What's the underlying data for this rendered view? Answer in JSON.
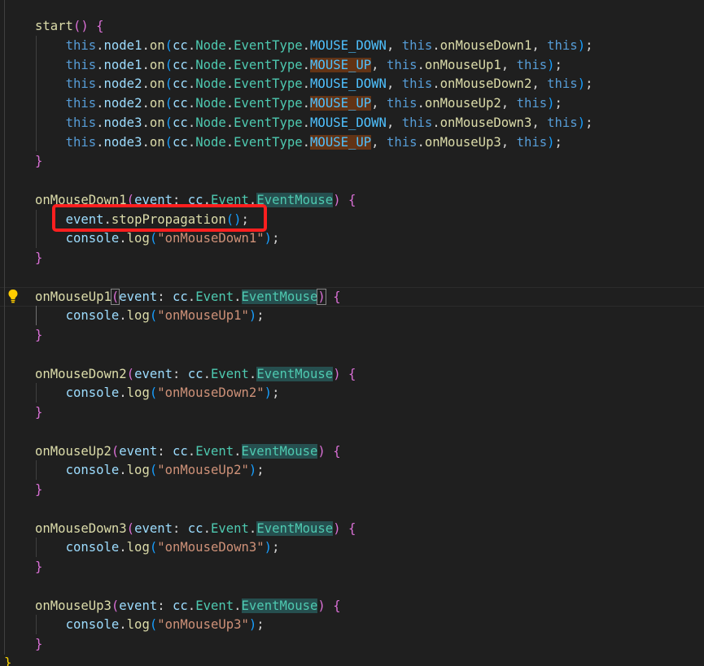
{
  "editor": {
    "lines": [
      [
        [
          "t-fn",
          "start"
        ],
        [
          "t-b2",
          "()"
        ],
        [
          "t-p",
          " "
        ],
        [
          "t-b2",
          "{"
        ]
      ],
      [
        [
          "t-p",
          "    "
        ],
        [
          "t-kw",
          "this"
        ],
        [
          "t-p",
          "."
        ],
        [
          "t-var",
          "node1"
        ],
        [
          "t-p",
          "."
        ],
        [
          "t-fn",
          "on"
        ],
        [
          "t-b3",
          "("
        ],
        [
          "t-var",
          "cc"
        ],
        [
          "t-p",
          "."
        ],
        [
          "t-type",
          "Node"
        ],
        [
          "t-p",
          "."
        ],
        [
          "t-type",
          "EventType"
        ],
        [
          "t-p",
          "."
        ],
        [
          "t-const",
          "MOUSE_DOWN"
        ],
        [
          "t-p",
          ", "
        ],
        [
          "t-kw",
          "this"
        ],
        [
          "t-p",
          "."
        ],
        [
          "t-fn",
          "onMouseDown1"
        ],
        [
          "t-p",
          ", "
        ],
        [
          "t-kw",
          "this"
        ],
        [
          "t-b3",
          ")"
        ],
        [
          "t-p",
          ";"
        ]
      ],
      [
        [
          "t-p",
          "    "
        ],
        [
          "t-kw",
          "this"
        ],
        [
          "t-p",
          "."
        ],
        [
          "t-var",
          "node1"
        ],
        [
          "t-p",
          "."
        ],
        [
          "t-fn",
          "on"
        ],
        [
          "t-b3",
          "("
        ],
        [
          "t-var",
          "cc"
        ],
        [
          "t-p",
          "."
        ],
        [
          "t-type",
          "Node"
        ],
        [
          "t-p",
          "."
        ],
        [
          "t-type",
          "EventType"
        ],
        [
          "t-p",
          "."
        ],
        [
          "t-const hl-up",
          "MOUSE_UP"
        ],
        [
          "t-p",
          ", "
        ],
        [
          "t-kw",
          "this"
        ],
        [
          "t-p",
          "."
        ],
        [
          "t-fn",
          "onMouseUp1"
        ],
        [
          "t-p",
          ", "
        ],
        [
          "t-kw",
          "this"
        ],
        [
          "t-b3",
          ")"
        ],
        [
          "t-p",
          ";"
        ]
      ],
      [
        [
          "t-p",
          "    "
        ],
        [
          "t-kw",
          "this"
        ],
        [
          "t-p",
          "."
        ],
        [
          "t-var",
          "node2"
        ],
        [
          "t-p",
          "."
        ],
        [
          "t-fn",
          "on"
        ],
        [
          "t-b3",
          "("
        ],
        [
          "t-var",
          "cc"
        ],
        [
          "t-p",
          "."
        ],
        [
          "t-type",
          "Node"
        ],
        [
          "t-p",
          "."
        ],
        [
          "t-type",
          "EventType"
        ],
        [
          "t-p",
          "."
        ],
        [
          "t-const",
          "MOUSE_DOWN"
        ],
        [
          "t-p",
          ", "
        ],
        [
          "t-kw",
          "this"
        ],
        [
          "t-p",
          "."
        ],
        [
          "t-fn",
          "onMouseDown2"
        ],
        [
          "t-p",
          ", "
        ],
        [
          "t-kw",
          "this"
        ],
        [
          "t-b3",
          ")"
        ],
        [
          "t-p",
          ";"
        ]
      ],
      [
        [
          "t-p",
          "    "
        ],
        [
          "t-kw",
          "this"
        ],
        [
          "t-p",
          "."
        ],
        [
          "t-var",
          "node2"
        ],
        [
          "t-p",
          "."
        ],
        [
          "t-fn",
          "on"
        ],
        [
          "t-b3",
          "("
        ],
        [
          "t-var",
          "cc"
        ],
        [
          "t-p",
          "."
        ],
        [
          "t-type",
          "Node"
        ],
        [
          "t-p",
          "."
        ],
        [
          "t-type",
          "EventType"
        ],
        [
          "t-p",
          "."
        ],
        [
          "t-const hl-up",
          "MOUSE_UP"
        ],
        [
          "t-p",
          ", "
        ],
        [
          "t-kw",
          "this"
        ],
        [
          "t-p",
          "."
        ],
        [
          "t-fn",
          "onMouseUp2"
        ],
        [
          "t-p",
          ", "
        ],
        [
          "t-kw",
          "this"
        ],
        [
          "t-b3",
          ")"
        ],
        [
          "t-p",
          ";"
        ]
      ],
      [
        [
          "t-p",
          "    "
        ],
        [
          "t-kw",
          "this"
        ],
        [
          "t-p",
          "."
        ],
        [
          "t-var",
          "node3"
        ],
        [
          "t-p",
          "."
        ],
        [
          "t-fn",
          "on"
        ],
        [
          "t-b3",
          "("
        ],
        [
          "t-var",
          "cc"
        ],
        [
          "t-p",
          "."
        ],
        [
          "t-type",
          "Node"
        ],
        [
          "t-p",
          "."
        ],
        [
          "t-type",
          "EventType"
        ],
        [
          "t-p",
          "."
        ],
        [
          "t-const",
          "MOUSE_DOWN"
        ],
        [
          "t-p",
          ", "
        ],
        [
          "t-kw",
          "this"
        ],
        [
          "t-p",
          "."
        ],
        [
          "t-fn",
          "onMouseDown3"
        ],
        [
          "t-p",
          ", "
        ],
        [
          "t-kw",
          "this"
        ],
        [
          "t-b3",
          ")"
        ],
        [
          "t-p",
          ";"
        ]
      ],
      [
        [
          "t-p",
          "    "
        ],
        [
          "t-kw",
          "this"
        ],
        [
          "t-p",
          "."
        ],
        [
          "t-var",
          "node3"
        ],
        [
          "t-p",
          "."
        ],
        [
          "t-fn",
          "on"
        ],
        [
          "t-b3",
          "("
        ],
        [
          "t-var",
          "cc"
        ],
        [
          "t-p",
          "."
        ],
        [
          "t-type",
          "Node"
        ],
        [
          "t-p",
          "."
        ],
        [
          "t-type",
          "EventType"
        ],
        [
          "t-p",
          "."
        ],
        [
          "t-const hl-up",
          "MOUSE_UP"
        ],
        [
          "t-p",
          ", "
        ],
        [
          "t-kw",
          "this"
        ],
        [
          "t-p",
          "."
        ],
        [
          "t-fn",
          "onMouseUp3"
        ],
        [
          "t-p",
          ", "
        ],
        [
          "t-kw",
          "this"
        ],
        [
          "t-b3",
          ")"
        ],
        [
          "t-p",
          ";"
        ]
      ],
      [
        [
          "t-b2",
          "}"
        ]
      ],
      [],
      [
        [
          "t-fn",
          "onMouseDown1"
        ],
        [
          "t-b2",
          "("
        ],
        [
          "t-var",
          "event"
        ],
        [
          "t-p",
          ": "
        ],
        [
          "t-var",
          "cc"
        ],
        [
          "t-p",
          "."
        ],
        [
          "t-type",
          "Event"
        ],
        [
          "t-p",
          "."
        ],
        [
          "t-type hl-type",
          "EventMouse"
        ],
        [
          "t-b2",
          ")"
        ],
        [
          "t-p",
          " "
        ],
        [
          "t-b2",
          "{"
        ]
      ],
      [
        [
          "t-p",
          "    "
        ],
        [
          "t-var",
          "event"
        ],
        [
          "t-p",
          "."
        ],
        [
          "t-fn",
          "stopPropagation"
        ],
        [
          "t-b3",
          "()"
        ],
        [
          "t-p",
          ";"
        ]
      ],
      [
        [
          "t-p",
          "    "
        ],
        [
          "t-var",
          "console"
        ],
        [
          "t-p",
          "."
        ],
        [
          "t-fn",
          "log"
        ],
        [
          "t-b3",
          "("
        ],
        [
          "t-str",
          "\"onMouseDown1\""
        ],
        [
          "t-b3",
          ")"
        ],
        [
          "t-p",
          ";"
        ]
      ],
      [
        [
          "t-b2",
          "}"
        ]
      ],
      [],
      [
        [
          "t-fn",
          "onMouseUp1"
        ],
        [
          "t-b2 bracket-match",
          "("
        ],
        [
          "t-var",
          "event"
        ],
        [
          "t-p",
          ": "
        ],
        [
          "t-var",
          "cc"
        ],
        [
          "t-p",
          "."
        ],
        [
          "t-type",
          "Event"
        ],
        [
          "t-p",
          "."
        ],
        [
          "t-type hl-type",
          "EventMouse"
        ],
        [
          "t-b2 bracket-match",
          ")"
        ],
        [
          "t-p",
          " "
        ],
        [
          "t-b2",
          "{"
        ]
      ],
      [
        [
          "t-p",
          "    "
        ],
        [
          "t-var",
          "console"
        ],
        [
          "t-p",
          "."
        ],
        [
          "t-fn",
          "log"
        ],
        [
          "t-b3",
          "("
        ],
        [
          "t-str",
          "\"onMouseUp1\""
        ],
        [
          "t-b3",
          ")"
        ],
        [
          "t-p",
          ";"
        ]
      ],
      [
        [
          "t-b2",
          "}"
        ]
      ],
      [],
      [
        [
          "t-fn",
          "onMouseDown2"
        ],
        [
          "t-b2",
          "("
        ],
        [
          "t-var",
          "event"
        ],
        [
          "t-p",
          ": "
        ],
        [
          "t-var",
          "cc"
        ],
        [
          "t-p",
          "."
        ],
        [
          "t-type",
          "Event"
        ],
        [
          "t-p",
          "."
        ],
        [
          "t-type hl-type",
          "EventMouse"
        ],
        [
          "t-b2",
          ")"
        ],
        [
          "t-p",
          " "
        ],
        [
          "t-b2",
          "{"
        ]
      ],
      [
        [
          "t-p",
          "    "
        ],
        [
          "t-var",
          "console"
        ],
        [
          "t-p",
          "."
        ],
        [
          "t-fn",
          "log"
        ],
        [
          "t-b3",
          "("
        ],
        [
          "t-str",
          "\"onMouseDown2\""
        ],
        [
          "t-b3",
          ")"
        ],
        [
          "t-p",
          ";"
        ]
      ],
      [
        [
          "t-b2",
          "}"
        ]
      ],
      [],
      [
        [
          "t-fn",
          "onMouseUp2"
        ],
        [
          "t-b2",
          "("
        ],
        [
          "t-var",
          "event"
        ],
        [
          "t-p",
          ": "
        ],
        [
          "t-var",
          "cc"
        ],
        [
          "t-p",
          "."
        ],
        [
          "t-type",
          "Event"
        ],
        [
          "t-p",
          "."
        ],
        [
          "t-type hl-type",
          "EventMouse"
        ],
        [
          "t-b2",
          ")"
        ],
        [
          "t-p",
          " "
        ],
        [
          "t-b2",
          "{"
        ]
      ],
      [
        [
          "t-p",
          "    "
        ],
        [
          "t-var",
          "console"
        ],
        [
          "t-p",
          "."
        ],
        [
          "t-fn",
          "log"
        ],
        [
          "t-b3",
          "("
        ],
        [
          "t-str",
          "\"onMouseUp2\""
        ],
        [
          "t-b3",
          ")"
        ],
        [
          "t-p",
          ";"
        ]
      ],
      [
        [
          "t-b2",
          "}"
        ]
      ],
      [],
      [
        [
          "t-fn",
          "onMouseDown3"
        ],
        [
          "t-b2",
          "("
        ],
        [
          "t-var",
          "event"
        ],
        [
          "t-p",
          ": "
        ],
        [
          "t-var",
          "cc"
        ],
        [
          "t-p",
          "."
        ],
        [
          "t-type",
          "Event"
        ],
        [
          "t-p",
          "."
        ],
        [
          "t-type hl-type",
          "EventMouse"
        ],
        [
          "t-b2",
          ")"
        ],
        [
          "t-p",
          " "
        ],
        [
          "t-b2",
          "{"
        ]
      ],
      [
        [
          "t-p",
          "    "
        ],
        [
          "t-var",
          "console"
        ],
        [
          "t-p",
          "."
        ],
        [
          "t-fn",
          "log"
        ],
        [
          "t-b3",
          "("
        ],
        [
          "t-str",
          "\"onMouseDown3\""
        ],
        [
          "t-b3",
          ")"
        ],
        [
          "t-p",
          ";"
        ]
      ],
      [
        [
          "t-b2",
          "}"
        ]
      ],
      [],
      [
        [
          "t-fn",
          "onMouseUp3"
        ],
        [
          "t-b2",
          "("
        ],
        [
          "t-var",
          "event"
        ],
        [
          "t-p",
          ": "
        ],
        [
          "t-var",
          "cc"
        ],
        [
          "t-p",
          "."
        ],
        [
          "t-type",
          "Event"
        ],
        [
          "t-p",
          "."
        ],
        [
          "t-type hl-type",
          "EventMouse"
        ],
        [
          "t-b2",
          ")"
        ],
        [
          "t-p",
          " "
        ],
        [
          "t-b2",
          "{"
        ]
      ],
      [
        [
          "t-p",
          "    "
        ],
        [
          "t-var",
          "console"
        ],
        [
          "t-p",
          "."
        ],
        [
          "t-fn",
          "log"
        ],
        [
          "t-b3",
          "("
        ],
        [
          "t-str",
          "\"onMouseUp3\""
        ],
        [
          "t-b3",
          ")"
        ],
        [
          "t-p",
          ";"
        ]
      ],
      [
        [
          "t-b2",
          "}"
        ]
      ]
    ],
    "closing_brace": "}",
    "current_line_index": 14,
    "annotated_line_index": 10
  },
  "icons": {
    "lightbulb": "lightbulb-icon"
  },
  "annotation": {
    "color": "#ff1f1f"
  },
  "colors": {
    "background": "#1f1f1f",
    "keyword": "#569cd6",
    "function": "#dcdcaa",
    "variable": "#9cdcfe",
    "type": "#4ec9b0",
    "constant": "#4fc1ff",
    "string": "#ce9178"
  }
}
